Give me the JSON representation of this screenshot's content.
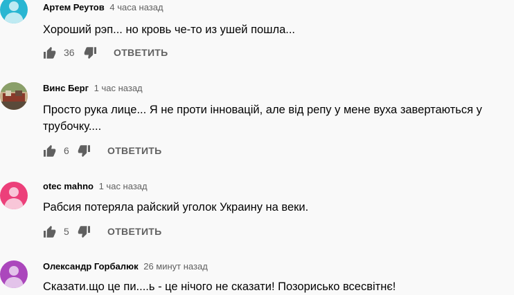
{
  "comments": [
    {
      "author": "Артем Реутов",
      "time": "4 часа назад",
      "text": "Хороший рэп... но кровь че-то из ушей пошла...",
      "likes": "36",
      "reply_label": "ОТВЕТИТЬ",
      "avatar_color": "#29b6d2",
      "avatar_icon": "person-icon"
    },
    {
      "author": "Винс Берг",
      "time": "1 час назад",
      "text": "Просто рука лице... Я не проти інновацій, але від репу у мене вуха завертаються у трубочку....",
      "likes": "6",
      "reply_label": "ОТВЕТИТЬ",
      "avatar_color": "#b08a5a",
      "avatar_icon": "photo-avatar"
    },
    {
      "author": "otec mahno",
      "time": "1 час назад",
      "text": "Рабсия потеряла райский уголок Украину на веки.",
      "likes": "5",
      "reply_label": "ОТВЕТИТЬ",
      "avatar_color": "#ec407a",
      "avatar_icon": "person-icon"
    },
    {
      "author": "Олександр Горбалюк",
      "time": "26 минут назад",
      "text": "Сказати.що це пи....ь - це нічого не сказати! Позорисько всесвітнє!",
      "likes": "",
      "reply_label": "",
      "avatar_color": "#ab47bc",
      "avatar_icon": "person-icon"
    }
  ]
}
